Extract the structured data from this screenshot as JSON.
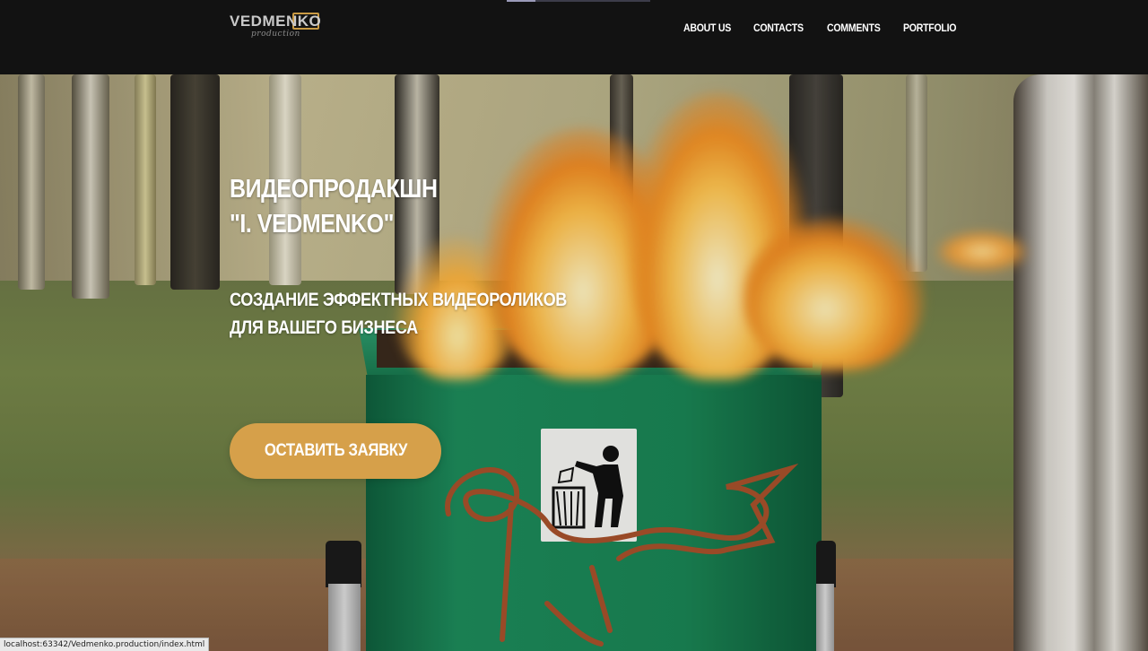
{
  "header": {
    "logo": {
      "brand": "VEDMENKO",
      "tagline": "production"
    },
    "nav": [
      {
        "label": "ABOUT US"
      },
      {
        "label": "CONTACTS"
      },
      {
        "label": "COMMENTS"
      },
      {
        "label": "PORTFOLIO"
      }
    ]
  },
  "hero": {
    "title_line1": "ВИДЕОПРОДАКШН",
    "title_line2": "\"I. VEDMENKO\"",
    "subtitle_line1": "СОЗДАНИЕ ЭФФЕКТНЫХ ВИДЕОРОЛИКОВ",
    "subtitle_line2": "ДЛЯ ВАШЕГО БИЗНЕСА",
    "cta_label": "ОСТАВИТЬ ЗАЯВКУ",
    "background_image": "burning-trash-bin-in-birch-forest"
  },
  "status_bar": {
    "url": "localhost:63342/Vedmenko.production/index.html"
  },
  "colors": {
    "header_bg": "#121212",
    "accent": "#d6a04a",
    "nav_text": "#ffffff",
    "logo_frame": "#c99a44"
  }
}
